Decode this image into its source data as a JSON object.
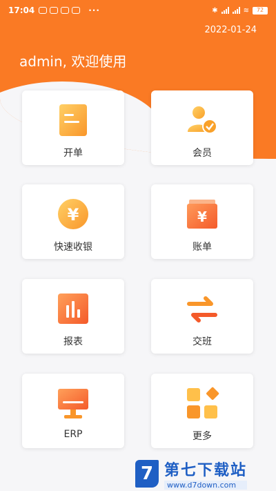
{
  "status_bar": {
    "time": "17:04",
    "more": "···",
    "battery": "72"
  },
  "header": {
    "date": "2022-01-24",
    "welcome": "admin, 欢迎使用"
  },
  "menu": [
    {
      "label": "开单",
      "icon": "order-icon"
    },
    {
      "label": "会员",
      "icon": "member-icon"
    },
    {
      "label": "快速收银",
      "icon": "quick-cashier-icon"
    },
    {
      "label": "账单",
      "icon": "bill-icon"
    },
    {
      "label": "报表",
      "icon": "report-icon"
    },
    {
      "label": "交班",
      "icon": "shift-handover-icon"
    },
    {
      "label": "ERP",
      "icon": "erp-icon"
    },
    {
      "label": "更多",
      "icon": "more-icon"
    }
  ],
  "watermark": {
    "logo": "7",
    "title": "第七下载站",
    "url": "www.d7down.com"
  },
  "colors": {
    "brand": "#fa7a24",
    "icon_gradient_start": "#ffb347",
    "icon_gradient_end": "#f9692a",
    "watermark": "#1f5fc4"
  }
}
